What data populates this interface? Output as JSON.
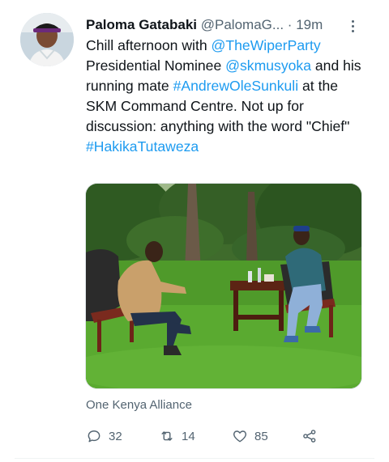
{
  "tweet": {
    "author_name": "Paloma Gatabaki",
    "author_handle": "@PalomaG...",
    "separator": "·",
    "time": "19m",
    "text": {
      "part1": "Chill afternoon with ",
      "mention1": "@TheWiperParty",
      "part2": " Presidential Nominee ",
      "mention2": "@skmusyoka",
      "part3": " and his running mate ",
      "hashtag1": "#AndrewOleSunkuli",
      "part4": " at the SKM Command Centre. Not up for discussion: anything with the word \"Chief\"",
      "hashtag2": "#HakikaTutaweza"
    },
    "location": "One Kenya Alliance",
    "actions": {
      "reply_count": "32",
      "retweet_count": "14",
      "like_count": "85"
    }
  },
  "colors": {
    "link": "#1d9bf0",
    "secondary": "#536471",
    "text": "#0f1419"
  }
}
